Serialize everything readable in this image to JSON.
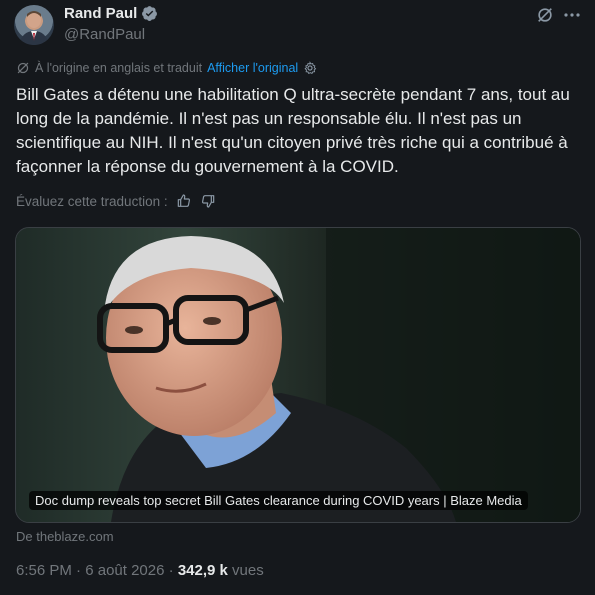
{
  "author": {
    "name": "Rand Paul",
    "handle": "@RandPaul"
  },
  "translation": {
    "origin_text": "À l'origine en anglais et traduit",
    "show_original": "Afficher l'original"
  },
  "tweet_text": "Bill Gates a détenu une habilitation Q ultra-secrète pendant 7 ans, tout au long de la pandémie. Il n'est pas un responsable élu. Il n'est pas un scientifique au NIH. Il n'est qu'un citoyen privé très riche qui a contribué à façonner la réponse du gouvernement à la COVID.",
  "rate_label": "Évaluez cette traduction :",
  "card": {
    "caption": "Doc dump reveals top secret Bill Gates clearance during COVID years | Blaze Media",
    "source": "De theblaze.com"
  },
  "meta": {
    "time": "6:56 PM",
    "separator": "·",
    "date": "6 août 2026",
    "views_count": "342,9 k",
    "views_label": "vues"
  },
  "icons": {
    "verified": "verified-badge-icon",
    "grok": "grok-icon",
    "more": "more-icon",
    "translate": "translate-icon",
    "settings": "gear-icon",
    "like": "thumbs-up-icon",
    "dislike": "thumbs-down-icon"
  },
  "colors": {
    "background": "#15181c",
    "text": "#e7e9ea",
    "secondary": "#71767b",
    "link": "#1d9bf0"
  }
}
